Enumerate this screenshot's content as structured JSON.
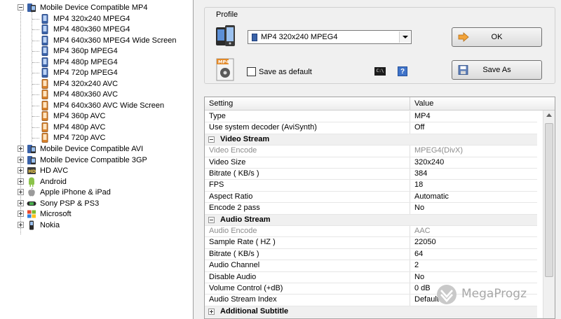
{
  "tree": {
    "root_open": {
      "label": "Mobile Device Compatible MP4",
      "children": [
        {
          "label": "MP4 320x240 MPEG4",
          "kind": "mpeg4"
        },
        {
          "label": "MP4 480x360 MPEG4",
          "kind": "mpeg4"
        },
        {
          "label": "MP4 640x360 MPEG4 Wide Screen",
          "kind": "mpeg4"
        },
        {
          "label": "MP4 360p MPEG4",
          "kind": "mpeg4"
        },
        {
          "label": "MP4 480p MPEG4",
          "kind": "mpeg4"
        },
        {
          "label": "MP4 720p MPEG4",
          "kind": "mpeg4"
        },
        {
          "label": "MP4 320x240 AVC",
          "kind": "avc"
        },
        {
          "label": "MP4 480x360 AVC",
          "kind": "avc"
        },
        {
          "label": "MP4 640x360 AVC Wide Screen",
          "kind": "avc"
        },
        {
          "label": "MP4 360p AVC",
          "kind": "avc"
        },
        {
          "label": "MP4 480p AVC",
          "kind": "avc"
        },
        {
          "label": "MP4 720p AVC",
          "kind": "avc"
        }
      ]
    },
    "collapsed": [
      {
        "label": "Mobile Device Compatible AVI",
        "icon": "device-icon"
      },
      {
        "label": "Mobile Device Compatible 3GP",
        "icon": "device-icon"
      },
      {
        "label": "HD AVC",
        "icon": "hd-icon"
      },
      {
        "label": "Android",
        "icon": "android-icon"
      },
      {
        "label": "Apple iPhone & iPad",
        "icon": "apple-icon"
      },
      {
        "label": "Sony PSP & PS3",
        "icon": "psp-icon"
      },
      {
        "label": "Microsoft",
        "icon": "windows-icon"
      },
      {
        "label": "Nokia",
        "icon": "phone-icon"
      }
    ]
  },
  "profile": {
    "legend": "Profile",
    "selected": "MP4 320x240 MPEG4",
    "ok_label": "OK",
    "save_as_label": "Save As",
    "save_default_label": "Save as default",
    "save_default_checked": false,
    "cmd_icon_text": "C:\\",
    "help_label": "?"
  },
  "grid": {
    "header_setting": "Setting",
    "header_value": "Value",
    "rows": [
      {
        "type": "row",
        "k": "Type",
        "v": "MP4"
      },
      {
        "type": "row",
        "k": "Use system decoder (AviSynth)",
        "v": "Off"
      },
      {
        "type": "cat",
        "k": "Video Stream",
        "open": true
      },
      {
        "type": "row",
        "k": "Video Encode",
        "v": "MPEG4(DivX)",
        "disabled": true
      },
      {
        "type": "row",
        "k": "Video Size",
        "v": "320x240"
      },
      {
        "type": "row",
        "k": "Bitrate ( KB/s )",
        "v": "384"
      },
      {
        "type": "row",
        "k": "FPS",
        "v": "18"
      },
      {
        "type": "row",
        "k": "Aspect Ratio",
        "v": "Automatic"
      },
      {
        "type": "row",
        "k": "Encode 2 pass",
        "v": "No"
      },
      {
        "type": "cat",
        "k": "Audio Stream",
        "open": true
      },
      {
        "type": "row",
        "k": "Audio Encode",
        "v": "AAC",
        "disabled": true
      },
      {
        "type": "row",
        "k": "Sample Rate ( HZ )",
        "v": "22050"
      },
      {
        "type": "row",
        "k": "Bitrate ( KB/s )",
        "v": "64"
      },
      {
        "type": "row",
        "k": "Audio Channel",
        "v": "2"
      },
      {
        "type": "row",
        "k": "Disable Audio",
        "v": "No"
      },
      {
        "type": "row",
        "k": "Volume Control (+dB)",
        "v": "0 dB"
      },
      {
        "type": "row",
        "k": "Audio Stream Index",
        "v": "Default"
      },
      {
        "type": "cat",
        "k": "Additional Subtitle",
        "open": false
      }
    ]
  },
  "watermark": {
    "text": "MegaProgz"
  },
  "colors": {
    "mpeg4_icon": "#3a62a8",
    "avc_icon": "#d9822b",
    "disabled_text": "#8c8c8c"
  }
}
